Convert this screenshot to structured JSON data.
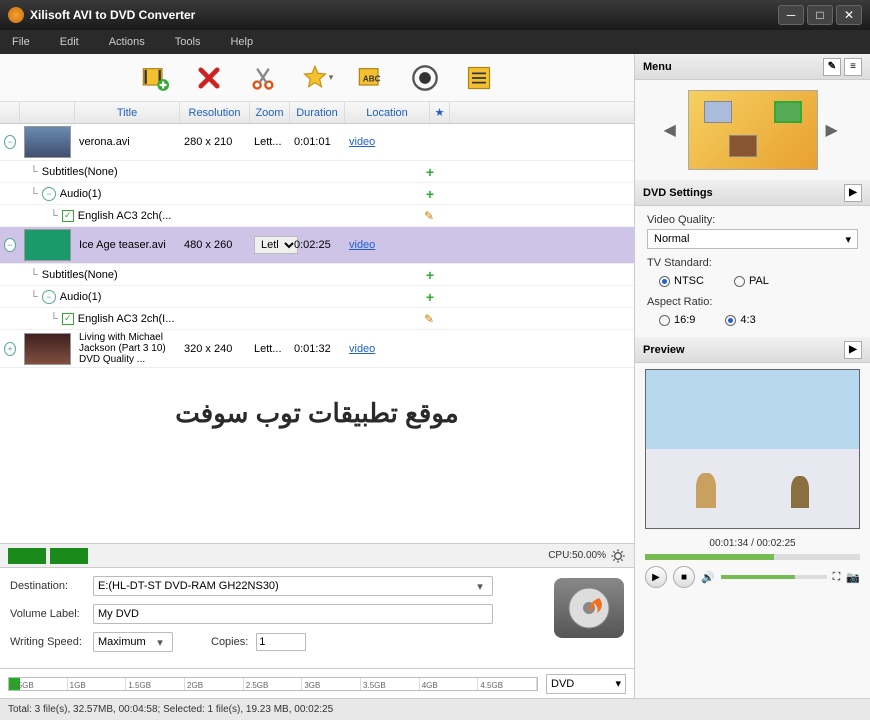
{
  "app": {
    "title": "Xilisoft AVI to DVD Converter"
  },
  "menu": {
    "file": "File",
    "edit": "Edit",
    "actions": "Actions",
    "tools": "Tools",
    "help": "Help"
  },
  "toolbar_icons": {
    "add": "add-video-icon",
    "delete": "delete-icon",
    "cut": "scissors-icon",
    "effects": "star-effects-icon",
    "subtitle": "subtitle-abc-icon",
    "record": "record-icon",
    "list": "list-icon"
  },
  "columns": {
    "title": "Title",
    "resolution": "Resolution",
    "zoom": "Zoom",
    "duration": "Duration",
    "location": "Location",
    "star": "★"
  },
  "files": [
    {
      "title": "verona.avi",
      "resolution": "280 x 210",
      "zoom": "Lett...",
      "duration": "0:01:01",
      "location": "video",
      "subs": "Subtitles(None)",
      "audio": "Audio(1)",
      "track": "English AC3 2ch(...",
      "selected": false
    },
    {
      "title": "Ice Age teaser.avi",
      "resolution": "480 x 260",
      "zoom": "Letl",
      "duration": "0:02:25",
      "location": "video",
      "subs": "Subtitles(None)",
      "audio": "Audio(1)",
      "track": "English AC3 2ch(I...",
      "selected": true
    },
    {
      "title": "Living with Michael Jackson (Part 3 10) DVD Quality ...",
      "resolution": "320 x 240",
      "zoom": "Lett...",
      "duration": "0:01:32",
      "location": "video",
      "selected": false
    }
  ],
  "watermark": "موقع تطبيقات توب سوفت",
  "cpu": {
    "label": "CPU:50.00%"
  },
  "dest": {
    "destination_label": "Destination:",
    "destination_value": "E:(HL-DT-ST DVD-RAM GH22NS30)",
    "volume_label": "Volume Label:",
    "volume_value": "My DVD",
    "speed_label": "Writing Speed:",
    "speed_value": "Maximum",
    "copies_label": "Copies:",
    "copies_value": "1"
  },
  "size_ticks": [
    "0.5GB",
    "1GB",
    "1.5GB",
    "2GB",
    "2.5GB",
    "3GB",
    "3.5GB",
    "4GB",
    "4.5GB"
  ],
  "dvd_select": "DVD",
  "status": "Total: 3 file(s), 32.57MB, 00:04:58; Selected: 1 file(s), 19.23 MB, 00:02:25",
  "right": {
    "menu_title": "Menu",
    "settings_title": "DVD Settings",
    "quality_label": "Video Quality:",
    "quality_value": "Normal",
    "tv_label": "TV Standard:",
    "tv_ntsc": "NTSC",
    "tv_pal": "PAL",
    "aspect_label": "Aspect Ratio:",
    "aspect_169": "16:9",
    "aspect_43": "4:3",
    "preview_title": "Preview",
    "preview_time": "00:01:34 / 00:02:25"
  }
}
